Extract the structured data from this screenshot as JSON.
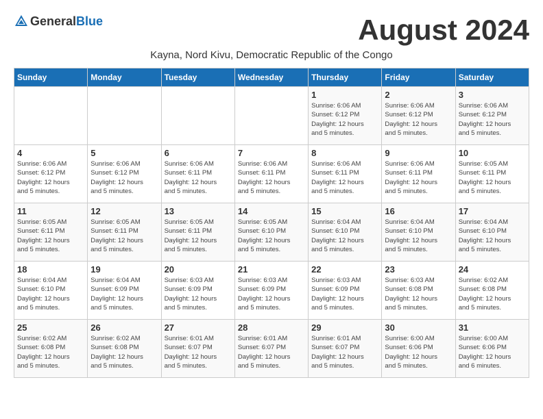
{
  "header": {
    "logo_general": "General",
    "logo_blue": "Blue",
    "month_title": "August 2024",
    "location": "Kayna, Nord Kivu, Democratic Republic of the Congo"
  },
  "calendar": {
    "days_of_week": [
      "Sunday",
      "Monday",
      "Tuesday",
      "Wednesday",
      "Thursday",
      "Friday",
      "Saturday"
    ],
    "weeks": [
      [
        {
          "day": "",
          "detail": ""
        },
        {
          "day": "",
          "detail": ""
        },
        {
          "day": "",
          "detail": ""
        },
        {
          "day": "",
          "detail": ""
        },
        {
          "day": "1",
          "detail": "Sunrise: 6:06 AM\nSunset: 6:12 PM\nDaylight: 12 hours\nand 5 minutes."
        },
        {
          "day": "2",
          "detail": "Sunrise: 6:06 AM\nSunset: 6:12 PM\nDaylight: 12 hours\nand 5 minutes."
        },
        {
          "day": "3",
          "detail": "Sunrise: 6:06 AM\nSunset: 6:12 PM\nDaylight: 12 hours\nand 5 minutes."
        }
      ],
      [
        {
          "day": "4",
          "detail": "Sunrise: 6:06 AM\nSunset: 6:12 PM\nDaylight: 12 hours\nand 5 minutes."
        },
        {
          "day": "5",
          "detail": "Sunrise: 6:06 AM\nSunset: 6:12 PM\nDaylight: 12 hours\nand 5 minutes."
        },
        {
          "day": "6",
          "detail": "Sunrise: 6:06 AM\nSunset: 6:11 PM\nDaylight: 12 hours\nand 5 minutes."
        },
        {
          "day": "7",
          "detail": "Sunrise: 6:06 AM\nSunset: 6:11 PM\nDaylight: 12 hours\nand 5 minutes."
        },
        {
          "day": "8",
          "detail": "Sunrise: 6:06 AM\nSunset: 6:11 PM\nDaylight: 12 hours\nand 5 minutes."
        },
        {
          "day": "9",
          "detail": "Sunrise: 6:06 AM\nSunset: 6:11 PM\nDaylight: 12 hours\nand 5 minutes."
        },
        {
          "day": "10",
          "detail": "Sunrise: 6:05 AM\nSunset: 6:11 PM\nDaylight: 12 hours\nand 5 minutes."
        }
      ],
      [
        {
          "day": "11",
          "detail": "Sunrise: 6:05 AM\nSunset: 6:11 PM\nDaylight: 12 hours\nand 5 minutes."
        },
        {
          "day": "12",
          "detail": "Sunrise: 6:05 AM\nSunset: 6:11 PM\nDaylight: 12 hours\nand 5 minutes."
        },
        {
          "day": "13",
          "detail": "Sunrise: 6:05 AM\nSunset: 6:11 PM\nDaylight: 12 hours\nand 5 minutes."
        },
        {
          "day": "14",
          "detail": "Sunrise: 6:05 AM\nSunset: 6:10 PM\nDaylight: 12 hours\nand 5 minutes."
        },
        {
          "day": "15",
          "detail": "Sunrise: 6:04 AM\nSunset: 6:10 PM\nDaylight: 12 hours\nand 5 minutes."
        },
        {
          "day": "16",
          "detail": "Sunrise: 6:04 AM\nSunset: 6:10 PM\nDaylight: 12 hours\nand 5 minutes."
        },
        {
          "day": "17",
          "detail": "Sunrise: 6:04 AM\nSunset: 6:10 PM\nDaylight: 12 hours\nand 5 minutes."
        }
      ],
      [
        {
          "day": "18",
          "detail": "Sunrise: 6:04 AM\nSunset: 6:10 PM\nDaylight: 12 hours\nand 5 minutes."
        },
        {
          "day": "19",
          "detail": "Sunrise: 6:04 AM\nSunset: 6:09 PM\nDaylight: 12 hours\nand 5 minutes."
        },
        {
          "day": "20",
          "detail": "Sunrise: 6:03 AM\nSunset: 6:09 PM\nDaylight: 12 hours\nand 5 minutes."
        },
        {
          "day": "21",
          "detail": "Sunrise: 6:03 AM\nSunset: 6:09 PM\nDaylight: 12 hours\nand 5 minutes."
        },
        {
          "day": "22",
          "detail": "Sunrise: 6:03 AM\nSunset: 6:09 PM\nDaylight: 12 hours\nand 5 minutes."
        },
        {
          "day": "23",
          "detail": "Sunrise: 6:03 AM\nSunset: 6:08 PM\nDaylight: 12 hours\nand 5 minutes."
        },
        {
          "day": "24",
          "detail": "Sunrise: 6:02 AM\nSunset: 6:08 PM\nDaylight: 12 hours\nand 5 minutes."
        }
      ],
      [
        {
          "day": "25",
          "detail": "Sunrise: 6:02 AM\nSunset: 6:08 PM\nDaylight: 12 hours\nand 5 minutes."
        },
        {
          "day": "26",
          "detail": "Sunrise: 6:02 AM\nSunset: 6:08 PM\nDaylight: 12 hours\nand 5 minutes."
        },
        {
          "day": "27",
          "detail": "Sunrise: 6:01 AM\nSunset: 6:07 PM\nDaylight: 12 hours\nand 5 minutes."
        },
        {
          "day": "28",
          "detail": "Sunrise: 6:01 AM\nSunset: 6:07 PM\nDaylight: 12 hours\nand 5 minutes."
        },
        {
          "day": "29",
          "detail": "Sunrise: 6:01 AM\nSunset: 6:07 PM\nDaylight: 12 hours\nand 5 minutes."
        },
        {
          "day": "30",
          "detail": "Sunrise: 6:00 AM\nSunset: 6:06 PM\nDaylight: 12 hours\nand 5 minutes."
        },
        {
          "day": "31",
          "detail": "Sunrise: 6:00 AM\nSunset: 6:06 PM\nDaylight: 12 hours\nand 6 minutes."
        }
      ]
    ]
  }
}
